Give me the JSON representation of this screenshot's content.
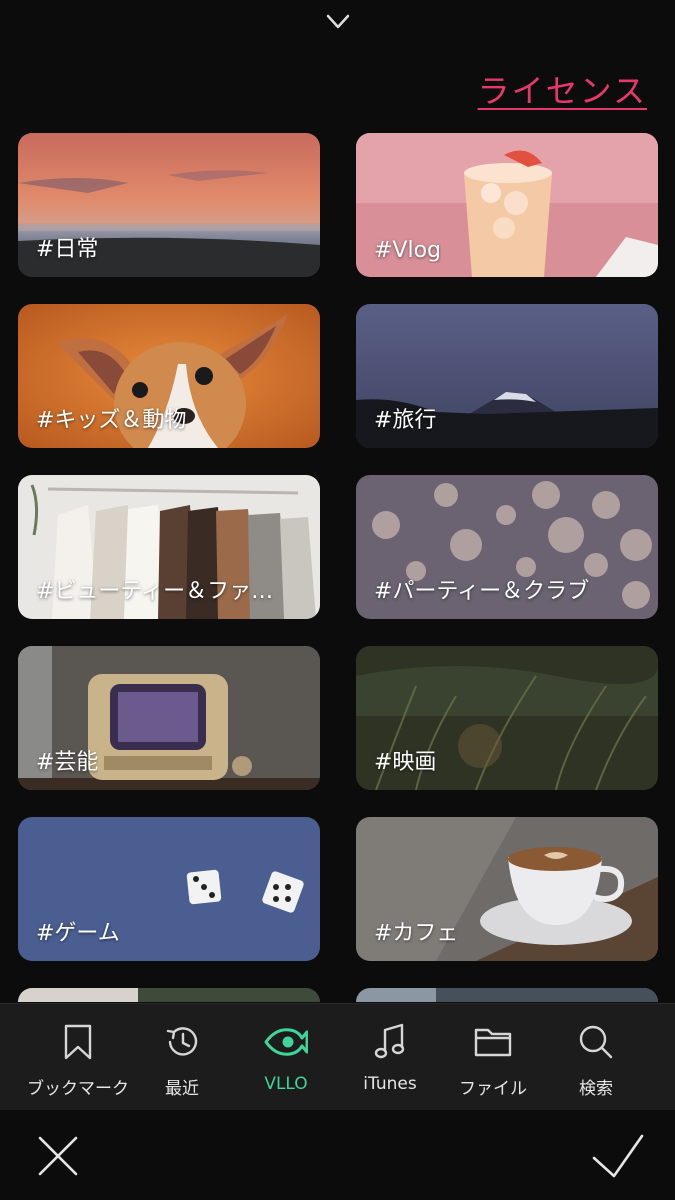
{
  "header": {
    "collapse_icon": "chevron-down-icon",
    "license_link": "ライセンス"
  },
  "categories": [
    {
      "label": "#日常"
    },
    {
      "label": "#Vlog"
    },
    {
      "label": "#キッズ＆動物"
    },
    {
      "label": "#旅行"
    },
    {
      "label": "#ビューティー＆ファ…"
    },
    {
      "label": "#パーティー＆クラブ"
    },
    {
      "label": "#芸能"
    },
    {
      "label": "#映画"
    },
    {
      "label": "#ゲーム"
    },
    {
      "label": "#カフェ"
    }
  ],
  "tabs": [
    {
      "label": "ブックマーク",
      "icon": "bookmark-icon"
    },
    {
      "label": "最近",
      "icon": "history-icon"
    },
    {
      "label": "VLLO",
      "icon": "vllo-fish-icon",
      "active": true
    },
    {
      "label": "iTunes",
      "icon": "music-note-icon"
    },
    {
      "label": "ファイル",
      "icon": "folder-icon"
    },
    {
      "label": "検索",
      "icon": "search-icon"
    }
  ],
  "actions": {
    "close_icon": "close-icon",
    "confirm_icon": "checkmark-icon"
  },
  "colors": {
    "accent": "#3ed598",
    "license": "#e8376a",
    "background": "#0c0c0c",
    "tabbar": "#1c1c1c"
  }
}
